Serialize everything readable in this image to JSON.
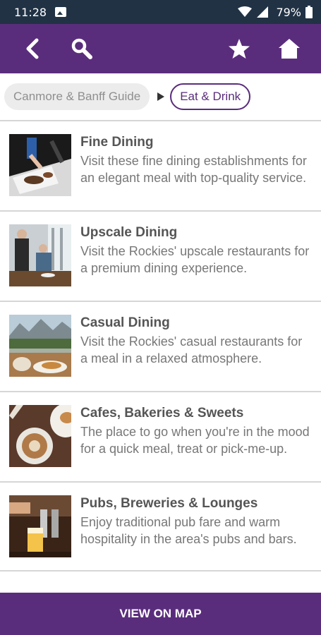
{
  "status_bar": {
    "time": "11:28",
    "battery": "79%",
    "icons": [
      "photo-icon",
      "wifi-icon",
      "signal-icon",
      "battery-icon"
    ]
  },
  "app_bar": {
    "color": "#5a2d7c",
    "icons": [
      "back-icon",
      "search-icon",
      "star-icon",
      "home-icon"
    ]
  },
  "breadcrumb": {
    "parent": "Canmore & Banff Guide",
    "current": "Eat & Drink"
  },
  "categories": [
    {
      "title": "Fine Dining",
      "description": "Visit these fine dining establishments for an elegant meal with top-quality service.",
      "image": "fine-dining-photo"
    },
    {
      "title": "Upscale Dining",
      "description": "Visit the Rockies' upscale restaurants for a premium dining experience.",
      "image": "upscale-dining-photo"
    },
    {
      "title": "Casual Dining",
      "description": "Visit the Rockies' casual restaurants for a meal in a relaxed atmosphere.",
      "image": "casual-dining-photo"
    },
    {
      "title": "Cafes, Bakeries & Sweets",
      "description": "The place to go when you're in the mood for a quick meal, treat or pick-me-up.",
      "image": "cafe-photo"
    },
    {
      "title": "Pubs, Breweries & Lounges",
      "description": "Enjoy traditional pub fare and warm hospitality in the area's pubs and bars.",
      "image": "pub-photo"
    }
  ],
  "bottom_bar": {
    "label": "VIEW ON MAP"
  }
}
